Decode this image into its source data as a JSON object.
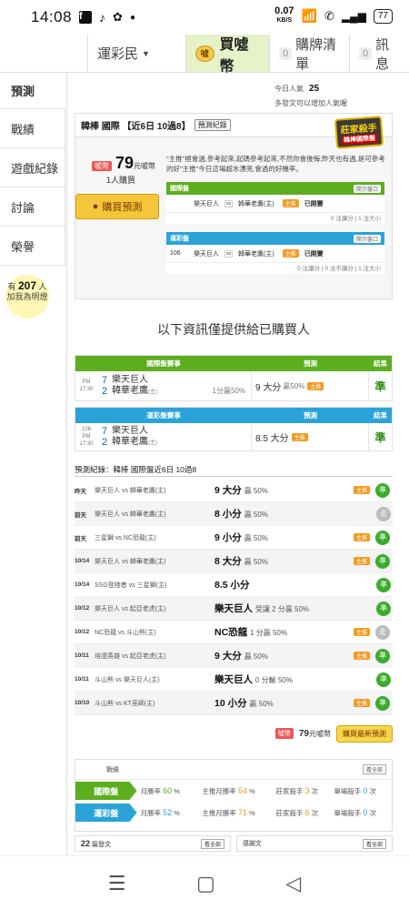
{
  "status": {
    "time": "14:08",
    "speed_value": "0.07",
    "speed_unit": "KB/S",
    "battery": "77"
  },
  "topnav": {
    "dropdown_label": "運彩民",
    "coins_label": "買噓幣",
    "cart_count": "0",
    "cart_label": "購牌清單",
    "msg_count": "0",
    "msg_label": "訊息"
  },
  "sidebar": {
    "items": [
      "預測",
      "戰績",
      "遊戲紀錄",
      "討論",
      "榮譽"
    ],
    "bulb_prefix": "有",
    "bulb_count": "207",
    "bulb_suffix": "人",
    "bulb_text": "加我為明燈"
  },
  "stats": {
    "today_label": "今日人氣",
    "today_value": "25",
    "line2": "多發文可以增加人氣喔"
  },
  "prediction": {
    "title": "韓棒 國際 【近6日 10過8】",
    "record_btn": "預測紀錄",
    "master_badge": "莊家殺手",
    "master_sub": "韓棒國際盤",
    "price_tag": "噓幣",
    "price_value": "79",
    "price_unit": "元噓幣",
    "buyers": "1人購買",
    "buy_btn": "購買預測",
    "desc": "\"主推\"極會過,參考起來,起碼參考起來,不然你會後悔;昨天也有過,是可參考的好\"主推\"今日這場超水漂亮,會過的好機率。",
    "intl": {
      "label": "國際盤",
      "btn": "開示盤口",
      "home": "樂天巨人",
      "vs": "vs",
      "away": "韓華老鷹(主)",
      "status": "已開賽",
      "foot": "0 注讓分 | 1 注大小"
    },
    "sport": {
      "label": "運彩盤",
      "btn": "開示盤口",
      "num": "106",
      "home": "樂天巨人",
      "vs": "vs",
      "away": "韓華老鷹(主)",
      "status": "已開賽",
      "foot": "0 注讓分 | 0 注不讓分 | 1 注大小"
    }
  },
  "notice": "以下資訊僅提供給已購買人",
  "intl_table": {
    "headers": [
      "國際盤賽事",
      "預測",
      "結果"
    ],
    "time": "PM 17:30",
    "score1": "7",
    "team1": "樂天巨人",
    "score2": "2",
    "team2": "韓華老鷹",
    "team2_tag": "(主)",
    "sub": "1分贏50%",
    "pred": "9 大分",
    "pred_sub": "贏50%",
    "pill": "主推",
    "result": "準"
  },
  "sport_table": {
    "headers": [
      "運彩盤賽事",
      "預測",
      "結果"
    ],
    "num": "106",
    "time": "PM 17:30",
    "score1": "7",
    "team1": "樂天巨人",
    "score2": "2",
    "team2": "韓華老鷹",
    "team2_tag": "(主)",
    "pred": "8.5 大分",
    "pill": "主推",
    "result": "準"
  },
  "history": {
    "title": "預測紀錄：韓棒 國際盤近6日 10過8",
    "rows": [
      {
        "date": "昨天",
        "game": "樂天巨人 vs 韓華老鷹(主)",
        "pick": "9 大分",
        "odds": "贏 50%",
        "pill": "主推",
        "res": "準"
      },
      {
        "date": "前天",
        "game": "樂天巨人 vs 韓華老鷹(主)",
        "pick": "8 小分",
        "odds": "贏 50%",
        "pill": "",
        "res": "走"
      },
      {
        "date": "前天",
        "game": "三星獅 vs NC恐龍(主)",
        "pick": "9 小分",
        "odds": "贏 50%",
        "pill": "主推",
        "res": "準"
      },
      {
        "date": "10/14",
        "game": "樂天巨人 vs 韓華老鷹(主)",
        "pick": "8 大分",
        "odds": "贏 50%",
        "pill": "主推",
        "res": "準"
      },
      {
        "date": "10/14",
        "game": "SSG登陸者 vs 三星獅(主)",
        "pick": "8.5 小分",
        "odds": "",
        "pill": "",
        "res": "準"
      },
      {
        "date": "10/12",
        "game": "樂天巨人 vs 起亞老虎(主)",
        "pick": "樂天巨人",
        "odds": "受讓 2 分贏 50%",
        "pill": "",
        "res": "準"
      },
      {
        "date": "10/12",
        "game": "NC恐龍 vs 斗山熊(主)",
        "pick": "NC恐龍",
        "odds": "1 分贏 50%",
        "pill": "主推",
        "res": "走"
      },
      {
        "date": "10/11",
        "game": "培證英雄 vs 起亞老虎(主)",
        "pick": "9 大分",
        "odds": "贏 50%",
        "pill": "主推",
        "res": "準"
      },
      {
        "date": "10/11",
        "game": "斗山熊 vs 樂天巨人(主)",
        "pick": "樂天巨人",
        "odds": "0 分輸 50%",
        "pill": "",
        "res": "準"
      },
      {
        "date": "10/10",
        "game": "斗山熊 vs KT巫師(主)",
        "pick": "10 小分",
        "odds": "贏 50%",
        "pill": "主推",
        "res": "準"
      }
    ]
  },
  "buyrow": {
    "tag": "噓幣",
    "price": "79",
    "unit": "元噓幣",
    "btn": "購買最新預測"
  },
  "record": {
    "title": "戰績",
    "btn": "看全部",
    "intl": {
      "label": "國際盤",
      "s1": "月勝率",
      "v1": "60",
      "s2": "主推月勝率",
      "v2": "64",
      "s3": "莊家殺手",
      "v3": "3",
      "s4": "單場殺手",
      "v4": "0",
      "unit_pct": "%",
      "unit_times": "次"
    },
    "sport": {
      "label": "運彩盤",
      "s1": "月勝率",
      "v1": "52",
      "s2": "主推月勝率",
      "v2": "71",
      "s3": "莊家殺手",
      "v3": "6",
      "s4": "單場殺手",
      "v4": "0",
      "unit_pct": "%",
      "unit_times": "次"
    }
  },
  "bottom": {
    "left_count": "22",
    "left_label": "篇發文",
    "left_btn": "看全部",
    "right_label": "感謝文",
    "right_btn": "看全部"
  },
  "colors": {
    "green": "#5cae1f",
    "blue": "#2ba3d9",
    "accent": "#f5c63a",
    "orange": "#f59a23"
  }
}
